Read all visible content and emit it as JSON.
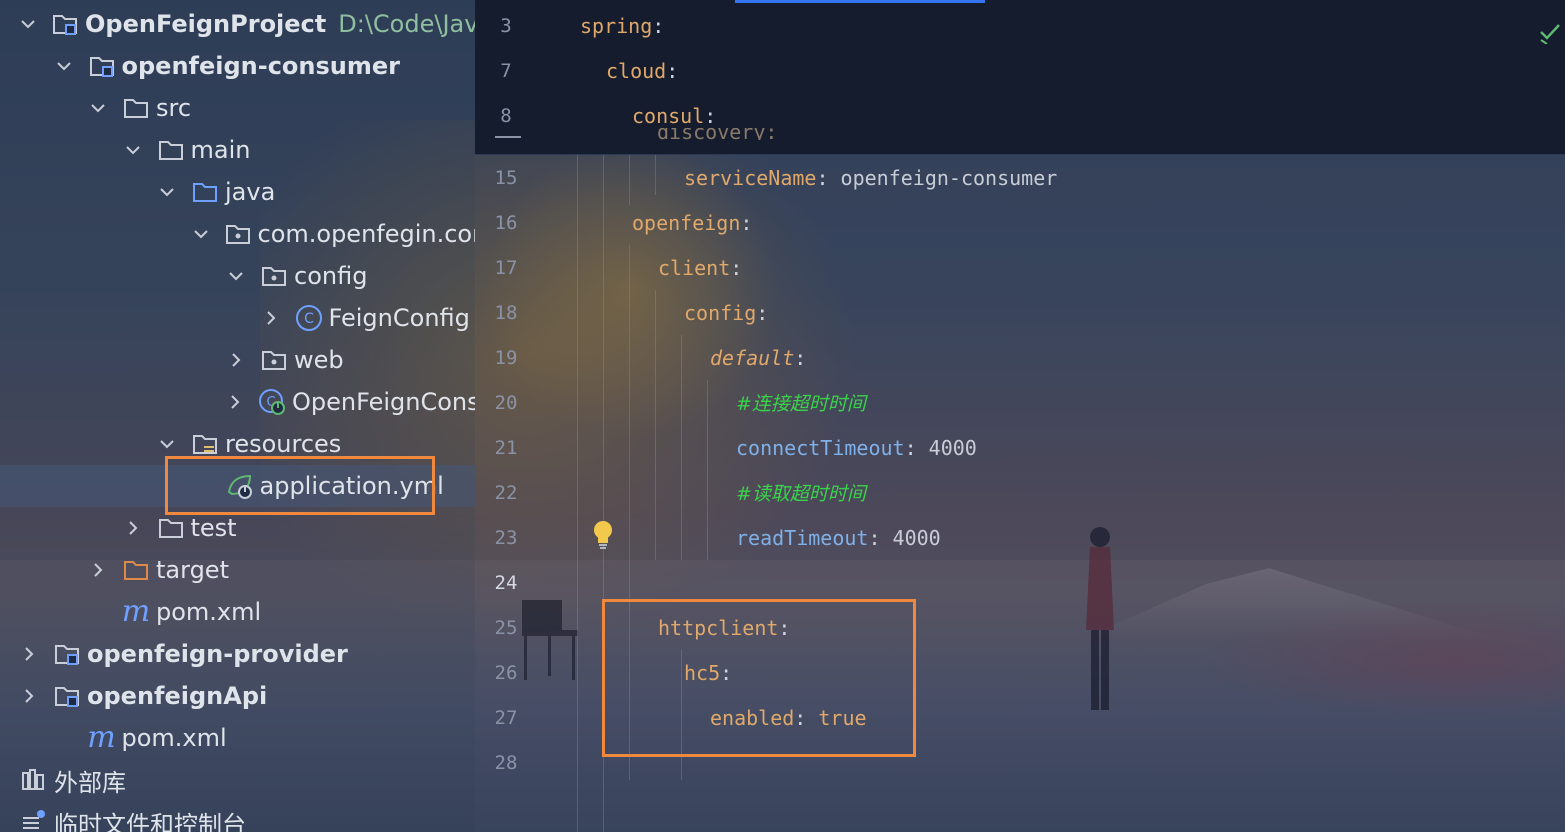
{
  "project_tree": [
    {
      "label": "OpenFeignProject",
      "path": "D:\\Code\\JavaCod",
      "bold": true,
      "indent": 0,
      "arrow": "down",
      "icon": "module-folder-icon"
    },
    {
      "label": "openfeign-consumer",
      "bold": true,
      "indent": 1,
      "arrow": "down",
      "icon": "module-folder-icon"
    },
    {
      "label": "src",
      "indent": 2,
      "arrow": "down",
      "icon": "folder-icon"
    },
    {
      "label": "main",
      "indent": 3,
      "arrow": "down",
      "icon": "folder-icon"
    },
    {
      "label": "java",
      "indent": 4,
      "arrow": "down",
      "icon": "source-folder-icon"
    },
    {
      "label": "com.openfegin.consu",
      "indent": 5,
      "arrow": "down",
      "icon": "package-icon"
    },
    {
      "label": "config",
      "indent": 6,
      "arrow": "down",
      "icon": "package-icon"
    },
    {
      "label": "FeignConfig",
      "indent": 7,
      "arrow": "right",
      "icon": "class-icon"
    },
    {
      "label": "web",
      "indent": 6,
      "arrow": "right",
      "icon": "package-icon"
    },
    {
      "label": "OpenFeignConsun",
      "indent": 6,
      "arrow": "right",
      "icon": "spring-boot-class-icon"
    },
    {
      "label": "resources",
      "indent": 4,
      "arrow": "down",
      "icon": "resources-folder-icon"
    },
    {
      "label": "application.yml",
      "indent": 5,
      "arrow": "none",
      "icon": "spring-yml-icon",
      "selected": true
    },
    {
      "label": "test",
      "indent": 3,
      "arrow": "right",
      "icon": "folder-icon"
    },
    {
      "label": "target",
      "indent": 2,
      "arrow": "right",
      "icon": "excluded-folder-icon"
    },
    {
      "label": "pom.xml",
      "indent": 2,
      "arrow": "none",
      "icon": "maven-icon"
    },
    {
      "label": "openfeign-provider",
      "bold": true,
      "indent": 0,
      "arrow": "right",
      "icon": "module-folder-icon"
    },
    {
      "label": "openfeignApi",
      "bold": true,
      "indent": 0,
      "arrow": "right",
      "icon": "module-folder-icon"
    },
    {
      "label": "pom.xml",
      "indent": 1,
      "arrow": "none",
      "icon": "maven-icon"
    },
    {
      "label": "外部库",
      "indent": -1,
      "arrow": "none",
      "icon": "library-icon"
    },
    {
      "label": "临时文件和控制台",
      "indent": -1,
      "arrow": "none",
      "icon": "scratches-icon"
    }
  ],
  "sticky_lines": [
    {
      "num": "3",
      "indent": 0,
      "key": "spring",
      "style": "k"
    },
    {
      "num": "7",
      "indent": 1,
      "key": "cloud",
      "style": "k"
    },
    {
      "num": "8",
      "indent": 2,
      "key": "consul",
      "style": "k"
    }
  ],
  "code_lines": [
    {
      "num": "15",
      "indent": 4,
      "key": "serviceName",
      "style": "k",
      "value": "openfeign-consumer"
    },
    {
      "num": "16",
      "indent": 2,
      "key": "openfeign",
      "style": "k"
    },
    {
      "num": "17",
      "indent": 3,
      "key": "client",
      "style": "k"
    },
    {
      "num": "18",
      "indent": 4,
      "key": "config",
      "style": "k"
    },
    {
      "num": "19",
      "indent": 5,
      "key": "default",
      "style": "kd"
    },
    {
      "num": "20",
      "indent": 6,
      "comment": "#连接超时时间"
    },
    {
      "num": "21",
      "indent": 6,
      "key": "connectTimeout",
      "style": "kb",
      "value": "4000"
    },
    {
      "num": "22",
      "indent": 6,
      "comment": "#读取超时时间"
    },
    {
      "num": "23",
      "indent": 6,
      "key": "readTimeout",
      "style": "kb",
      "value": "4000"
    },
    {
      "num": "24",
      "indent": 0,
      "current": true
    },
    {
      "num": "25",
      "indent": 3,
      "key": "httpclient",
      "style": "k"
    },
    {
      "num": "26",
      "indent": 4,
      "key": "hc5",
      "style": "k"
    },
    {
      "num": "27",
      "indent": 5,
      "key": "enabled",
      "style": "k",
      "value": "true",
      "value_style": "tr"
    },
    {
      "num": "28",
      "indent": 0
    }
  ],
  "colors": {
    "highlight": "#f0883e",
    "accent": "#3574f0",
    "comment": "#39d34a"
  }
}
